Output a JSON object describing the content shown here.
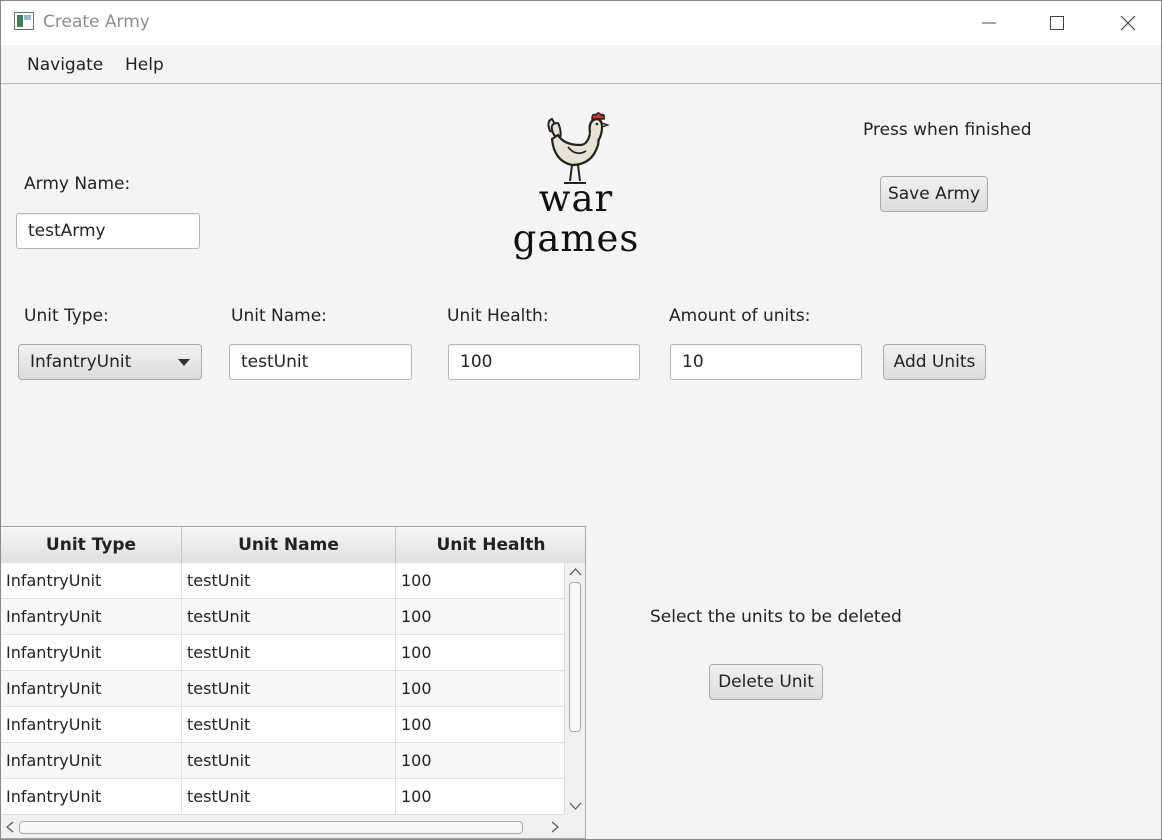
{
  "window": {
    "title": "Create Army"
  },
  "menu": {
    "items": [
      "Navigate",
      "Help"
    ]
  },
  "logo": {
    "line1": "war",
    "line2": "games"
  },
  "army_name": {
    "label": "Army Name:",
    "value": "testArmy"
  },
  "save": {
    "hint": "Press when finished",
    "button": "Save Army"
  },
  "unit_form": {
    "unit_type_label": "Unit Type:",
    "unit_type_value": "InfantryUnit",
    "unit_name_label": "Unit Name:",
    "unit_name_value": "testUnit",
    "unit_health_label": "Unit Health:",
    "unit_health_value": "100",
    "amount_label": "Amount of units:",
    "amount_value": "10",
    "add_button": "Add Units"
  },
  "table": {
    "columns": [
      "Unit Type",
      "Unit Name",
      "Unit Health"
    ],
    "rows": [
      [
        "InfantryUnit",
        "testUnit",
        "100"
      ],
      [
        "InfantryUnit",
        "testUnit",
        "100"
      ],
      [
        "InfantryUnit",
        "testUnit",
        "100"
      ],
      [
        "InfantryUnit",
        "testUnit",
        "100"
      ],
      [
        "InfantryUnit",
        "testUnit",
        "100"
      ],
      [
        "InfantryUnit",
        "testUnit",
        "100"
      ],
      [
        "InfantryUnit",
        "testUnit",
        "100"
      ]
    ]
  },
  "delete": {
    "hint": "Select the units to be deleted",
    "button": "Delete Unit"
  },
  "icons": {
    "app": "app-icon",
    "minimize": "minimize-icon",
    "maximize": "maximize-icon",
    "close": "close-icon",
    "logo": "chicken-icon",
    "dropdown": "chevron-down-icon"
  },
  "colors": {
    "background": "#f4f4f4",
    "titlebar": "#ffffff",
    "title_text": "#8d8d8d",
    "comb": "#d8322b"
  }
}
